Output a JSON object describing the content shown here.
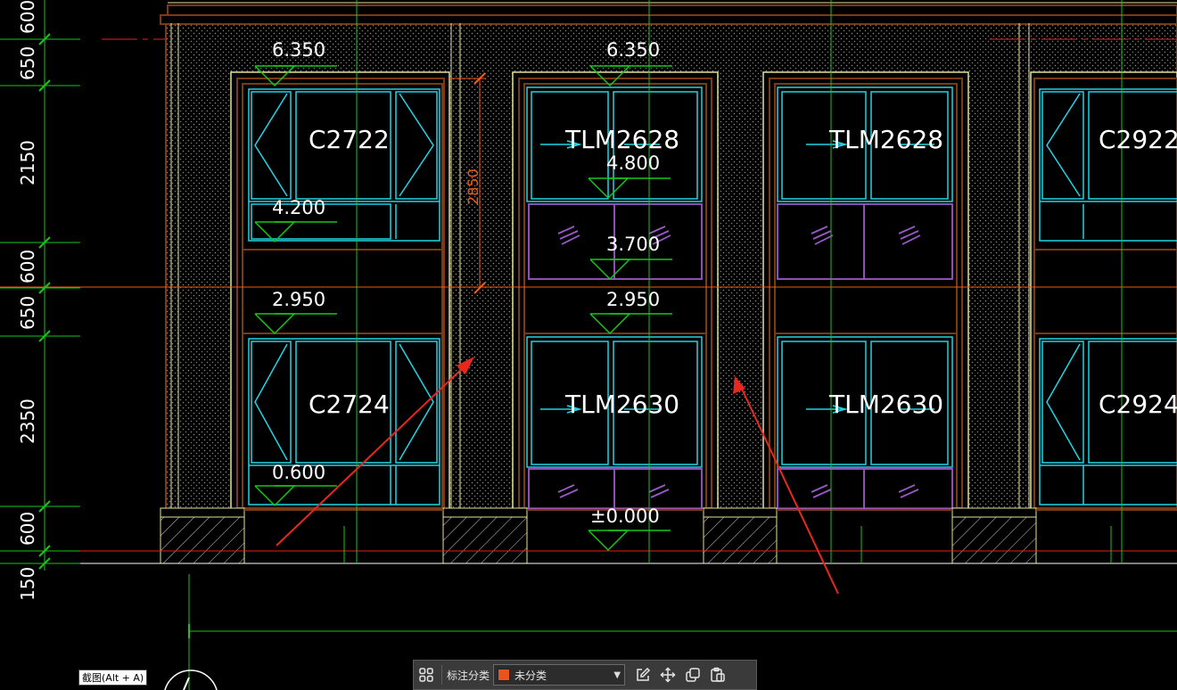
{
  "drawing": {
    "left_dimensions": [
      "600",
      "650",
      "2150",
      "600",
      "650",
      "2350",
      "600",
      "150"
    ],
    "vertical_dimension": "2850",
    "windows": [
      {
        "top_label": "C2722",
        "bottom_label": "C2724"
      },
      {
        "top_label": "TLM2628",
        "bottom_label": "TLM2630"
      },
      {
        "top_label": "TLM2628",
        "bottom_label": "TLM2630"
      },
      {
        "top_label": "C2922",
        "bottom_label": "C2924"
      }
    ],
    "levels": {
      "col1": [
        "6.350",
        "4.200",
        "2.950",
        "0.600"
      ],
      "col2": [
        "6.350",
        "4.800",
        "3.700",
        "2.950",
        "±0.000"
      ]
    },
    "colors": {
      "background": "#000000",
      "wall": "#7a3a14",
      "frame": "#e6e29a",
      "glass": "#1fd6e6",
      "transom": "#9a59c9",
      "grid": "#17c61a",
      "axis": "#e61e1e",
      "dimension": "#ef5a14",
      "arrow": "#e8281e",
      "dot": "#8a8a8a"
    }
  },
  "tooltip": {
    "text": "截图(Alt + A)"
  },
  "toolbar": {
    "category_label": "标注分类",
    "category_value": "未分类",
    "category_color": "#e8541b",
    "icons": [
      "grid-icon",
      "edit-icon",
      "move-icon",
      "copy-icon",
      "paste-icon"
    ]
  }
}
